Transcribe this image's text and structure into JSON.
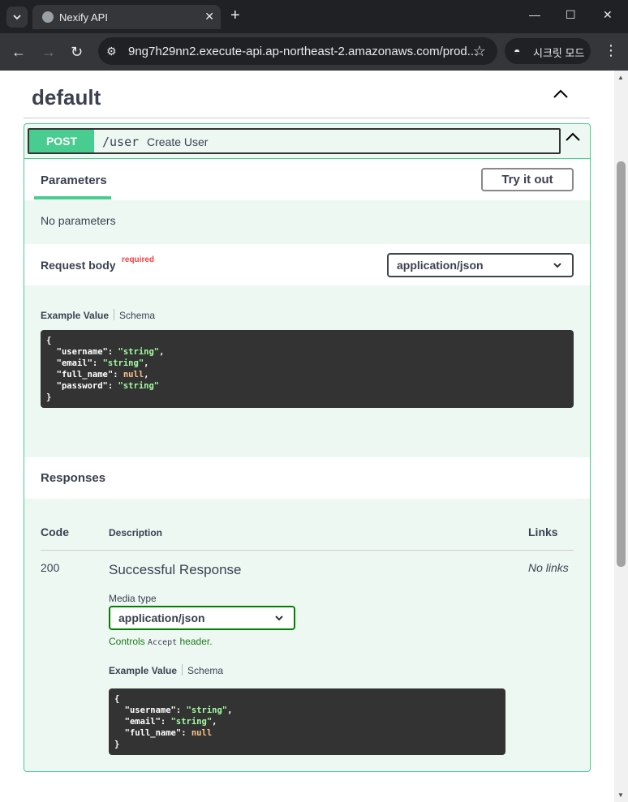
{
  "browser": {
    "tab_title": "Nexify API",
    "url": "9ng7h29nn2.execute-api.ap-northeast-2.amazonaws.com/prod...",
    "incognito_label": "시크릿 모드"
  },
  "section": {
    "title": "default"
  },
  "operation": {
    "method": "POST",
    "path": "/user",
    "summary": "Create User",
    "parameters_tab": "Parameters",
    "try_it_out": "Try it out",
    "no_parameters": "No parameters",
    "request_body_label": "Request body",
    "required_label": "required",
    "request_content_type": "application/json",
    "example_value_tab": "Example Value",
    "schema_tab": "Schema",
    "request_example": {
      "open": "{",
      "close": "}",
      "fields": [
        {
          "key": "\"username\"",
          "value": "\"string\"",
          "type": "string",
          "comma": ","
        },
        {
          "key": "\"email\"",
          "value": "\"string\"",
          "type": "string",
          "comma": ","
        },
        {
          "key": "\"full_name\"",
          "value": "null",
          "type": "null",
          "comma": ","
        },
        {
          "key": "\"password\"",
          "value": "\"string\"",
          "type": "string",
          "comma": ""
        }
      ]
    },
    "responses": {
      "title": "Responses",
      "col_code": "Code",
      "col_description": "Description",
      "col_links": "Links",
      "rows": [
        {
          "code": "200",
          "description": "Successful Response",
          "links": "No links",
          "media_type_label": "Media type",
          "media_type": "application/json",
          "controls_prefix": "Controls",
          "controls_code": "Accept",
          "controls_suffix": "header.",
          "example_value_tab": "Example Value",
          "schema_tab": "Schema",
          "example": {
            "open": "{",
            "close": "}",
            "fields": [
              {
                "key": "\"username\"",
                "value": "\"string\"",
                "type": "string",
                "comma": ","
              },
              {
                "key": "\"email\"",
                "value": "\"string\"",
                "type": "string",
                "comma": ","
              },
              {
                "key": "\"full_name\"",
                "value": "null",
                "type": "null",
                "comma": ""
              }
            ]
          }
        }
      ]
    }
  },
  "colors": {
    "post_green": "#49cc90",
    "op_bg": "#edf8f2",
    "code_bg": "#333333",
    "string_green": "#a2fca2",
    "null_orange": "#fcc28c"
  }
}
